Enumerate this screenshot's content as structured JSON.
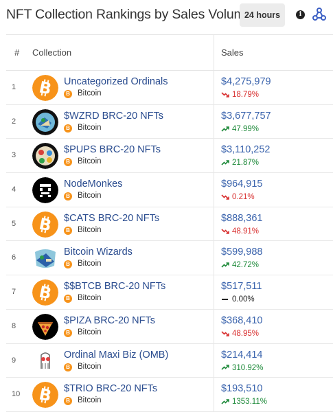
{
  "header": {
    "title": "NFT Collection Rankings by Sales Volume",
    "time_range": "24 hours",
    "info_icon": "info-icon",
    "logo_icon": "network-logo-icon"
  },
  "table": {
    "columns": {
      "rank": "#",
      "collection": "Collection",
      "sales": "Sales"
    },
    "rows": [
      {
        "rank": "1",
        "name": "Uncategorized Ordinals",
        "chain": "Bitcoin",
        "sales": "$4,275,979",
        "change": "18.79%",
        "direction": "down",
        "avatar": "bitcoin"
      },
      {
        "rank": "2",
        "name": "$WZRD BRC-20 NFTs",
        "chain": "Bitcoin",
        "sales": "$3,677,757",
        "change": "47.99%",
        "direction": "up",
        "avatar": "wzrd"
      },
      {
        "rank": "3",
        "name": "$PUPS BRC-20 NFTs",
        "chain": "Bitcoin",
        "sales": "$3,110,252",
        "change": "21.87%",
        "direction": "up",
        "avatar": "pups"
      },
      {
        "rank": "4",
        "name": "NodeMonkes",
        "chain": "Bitcoin",
        "sales": "$964,915",
        "change": "0.21%",
        "direction": "down",
        "avatar": "nodemonkes"
      },
      {
        "rank": "5",
        "name": "$CATS BRC-20 NFTs",
        "chain": "Bitcoin",
        "sales": "$888,361",
        "change": "48.91%",
        "direction": "down",
        "avatar": "bitcoin"
      },
      {
        "rank": "6",
        "name": "Bitcoin Wizards",
        "chain": "Bitcoin",
        "sales": "$599,988",
        "change": "42.72%",
        "direction": "up",
        "avatar": "wizards"
      },
      {
        "rank": "7",
        "name": "$$BTCB BRC-20 NFTs",
        "chain": "Bitcoin",
        "sales": "$517,511",
        "change": "0.00%",
        "direction": "flat",
        "avatar": "bitcoin"
      },
      {
        "rank": "8",
        "name": "$PIZA BRC-20 NFTs",
        "chain": "Bitcoin",
        "sales": "$368,410",
        "change": "48.95%",
        "direction": "down",
        "avatar": "piza"
      },
      {
        "rank": "9",
        "name": "Ordinal Maxi Biz (OMB)",
        "chain": "Bitcoin",
        "sales": "$214,414",
        "change": "310.92%",
        "direction": "up",
        "avatar": "omb"
      },
      {
        "rank": "10",
        "name": "$TRIO BRC-20 NFTs",
        "chain": "Bitcoin",
        "sales": "$193,510",
        "change": "1353.11%",
        "direction": "up",
        "avatar": "bitcoin"
      }
    ]
  },
  "colors": {
    "link": "#2a4c8f",
    "sales": "#3b64ad",
    "up": "#1e8a3a",
    "down": "#d83030",
    "bitcoin": "#f7931a"
  }
}
